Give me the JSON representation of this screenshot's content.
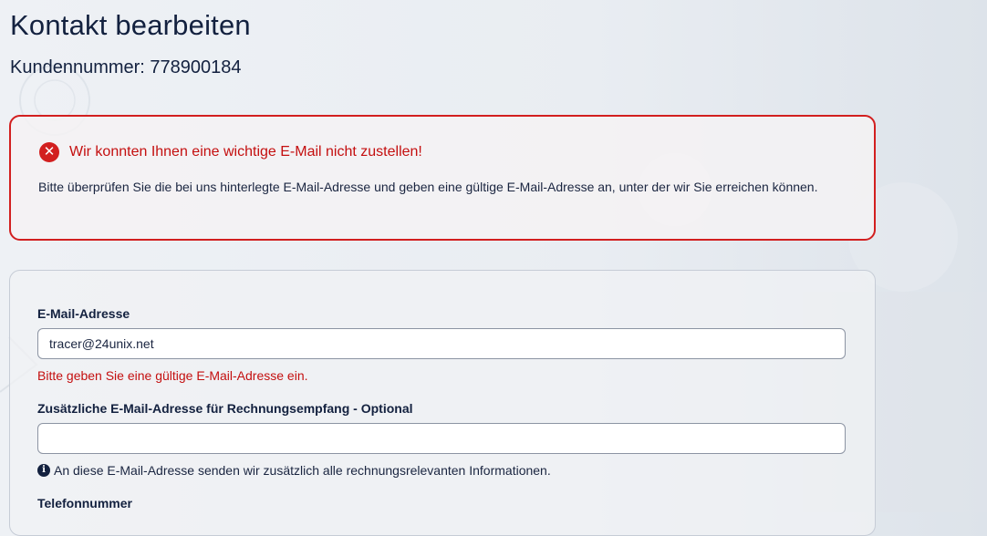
{
  "page": {
    "title": "Kontakt bearbeiten",
    "customer_number": "Kundennummer: 778900184"
  },
  "alert": {
    "icon": "error-circle-icon",
    "title": "Wir konnten Ihnen eine wichtige E-Mail nicht zustellen!",
    "text": "Bitte überprüfen Sie die bei uns hinterlegte E-Mail-Adresse und geben eine gültige E-Mail-Adresse an, unter der wir Sie erreichen können.",
    "color": "#d21f1f"
  },
  "form": {
    "email": {
      "label": "E-Mail-Adresse",
      "value": "tracer@24unix.net",
      "error": "Bitte geben Sie eine gültige E-Mail-Adresse ein."
    },
    "billing_email": {
      "label": "Zusätzliche E-Mail-Adresse für Rechnungsempfang - Optional",
      "value": "",
      "hint_icon": "info-icon",
      "hint": "An diese E-Mail-Adresse senden wir zusätzlich alle rechnungsrelevanten Informationen."
    },
    "phone": {
      "label": "Telefonnummer"
    }
  }
}
